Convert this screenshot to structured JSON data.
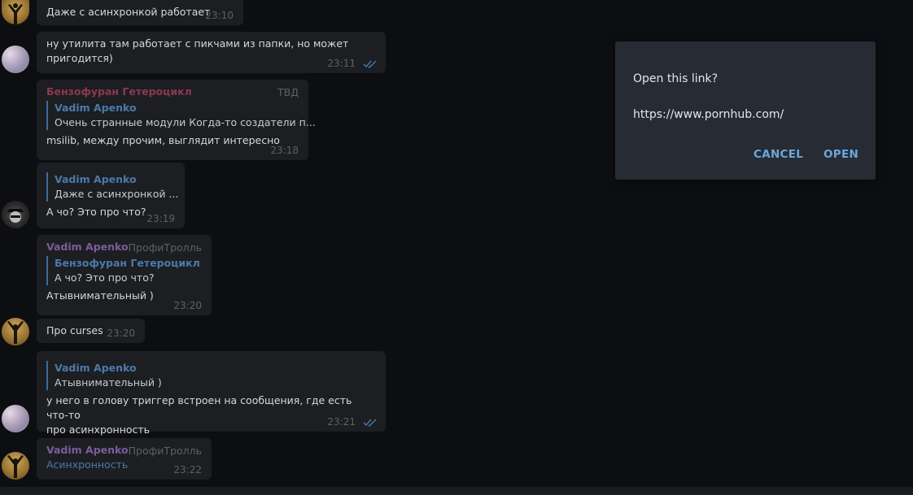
{
  "messages": [
    {
      "text": "Даже с асинхронкой работает",
      "time": "23:10"
    },
    {
      "text_line1": "ну утилита там работает с пикчами из папки, но может",
      "text_line2": "пригодится)",
      "time": "23:11"
    },
    {
      "sender": "Бензофуран Гетероцикл",
      "tag": "ТВД",
      "quote_name": "Vadim Apenko",
      "quote_text": "Очень странные модули  Когда-то создатели п...",
      "text": "msilib, между прочим, выглядит интересно",
      "time": "23:18"
    },
    {
      "quote_name": "Vadim Apenko",
      "quote_text": "Даже с асинхронкой ...",
      "text": "А чо? Это про что?",
      "time": "23:19"
    },
    {
      "sender": "Vadim Apenko",
      "tag": "ПрофиТролль",
      "quote_name": "Бензофуран Гетероцикл",
      "quote_text": "А чо? Это про что?",
      "text": "Атывнимательный )",
      "time": "23:20"
    },
    {
      "text": "Про curses",
      "time": "23:20"
    },
    {
      "quote_name": "Vadim Apenko",
      "quote_text": "Атывнимательный )",
      "text_line1": "у него в голову триггер встроен на сообщения, где есть что-то",
      "text_line2": "про асинхронность",
      "time": "23:21"
    },
    {
      "sender": "Vadim Apenko",
      "tag": "ПрофиТролль",
      "text": "Асинхронность",
      "time": "23:22"
    }
  ],
  "dialog": {
    "title": "Open this link?",
    "url": "https://www.pornhub.com/",
    "cancel_label": "CANCEL",
    "open_label": "OPEN"
  },
  "colors": {
    "background": "#0d0e11",
    "bubble": "#1c1e22",
    "accent": "#6aa8dc",
    "quote_bar": "#3f6b9a",
    "sender_red": "#8b3a4f",
    "sender_purple": "#7a5d9c"
  }
}
